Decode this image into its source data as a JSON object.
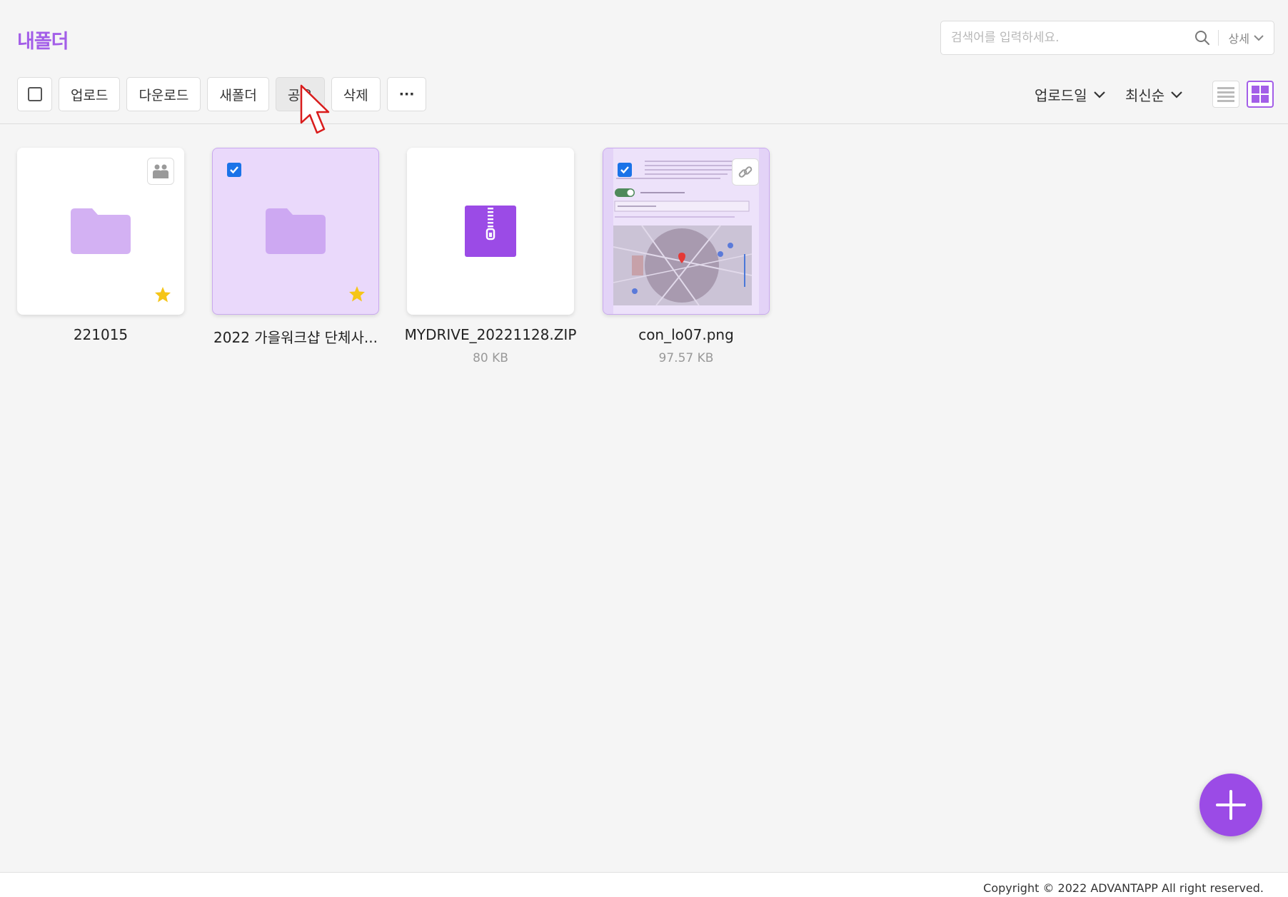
{
  "page": {
    "title": "내폴더"
  },
  "search": {
    "placeholder": "검색어를 입력하세요.",
    "value": "",
    "detail_label": "상세"
  },
  "toolbar": {
    "upload_label": "업로드",
    "download_label": "다운로드",
    "new_folder_label": "새폴더",
    "share_label": "공유",
    "delete_label": "삭제",
    "more_label": "···"
  },
  "sort": {
    "field_label": "업로드일",
    "order_label": "최신순"
  },
  "view": {
    "mode": "grid"
  },
  "items": [
    {
      "name": "221015",
      "type": "folder",
      "size": "",
      "selected": false,
      "starred": true,
      "shared": true
    },
    {
      "name": "2022 가을워크샵 단체사...",
      "type": "folder",
      "size": "",
      "selected": true,
      "starred": true,
      "shared": false
    },
    {
      "name": "MYDRIVE_20221128.ZIP",
      "type": "zip",
      "size": "80 KB",
      "selected": false,
      "starred": false,
      "shared": false
    },
    {
      "name": "con_lo07.png",
      "type": "image",
      "size": "97.57 KB",
      "selected": true,
      "starred": false,
      "link": true
    }
  ],
  "footer": {
    "copyright": "Copyright © 2022 ADVANTAPP All right reserved."
  },
  "colors": {
    "accent": "#a35ee8",
    "folder": "#d3b1f3",
    "selected_bg": "#ead9fb",
    "fab": "#9b4be6",
    "star": "#f5c518"
  }
}
